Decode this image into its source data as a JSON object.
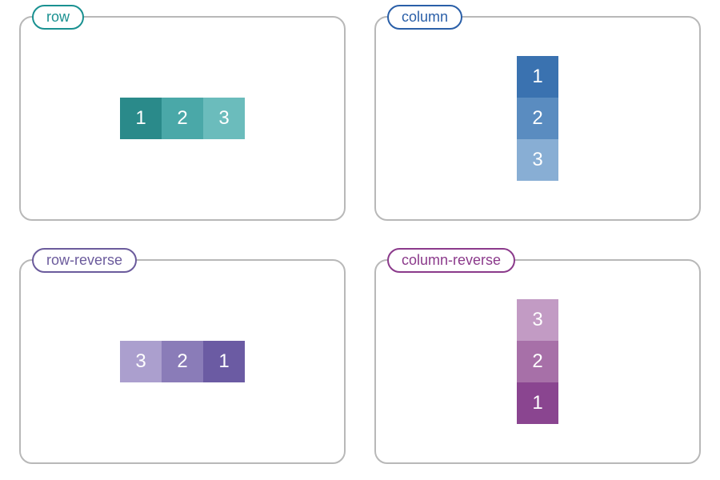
{
  "panels": [
    {
      "label": "row",
      "boxes": [
        "1",
        "2",
        "3"
      ]
    },
    {
      "label": "column",
      "boxes": [
        "1",
        "2",
        "3"
      ]
    },
    {
      "label": "row-reverse",
      "boxes": [
        "1",
        "2",
        "3"
      ]
    },
    {
      "label": "column-reverse",
      "boxes": [
        "1",
        "2",
        "3"
      ]
    }
  ]
}
